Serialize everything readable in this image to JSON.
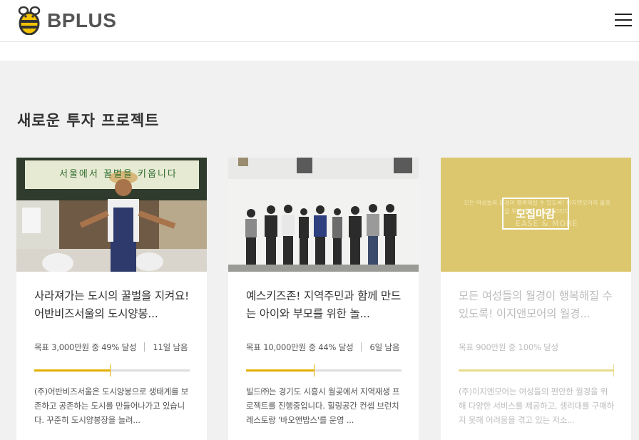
{
  "header": {
    "logo_text": "BPLUS",
    "logo_icon": "bee-icon",
    "menu_icon": "hamburger-menu-icon"
  },
  "section": {
    "title": "새로운 투자 프로젝트"
  },
  "colors": {
    "accent": "#e3b000",
    "closed_overlay": "#dcc76e",
    "background": "#f1f1f1"
  },
  "cards": [
    {
      "title": "사라져가는 도시의 꿀벌을 지켜요! 어반비즈서울의 도시양봉...",
      "goal": "목표 3,000만원 중 49% 달성",
      "remaining": "11일 남음",
      "progress": 0.49,
      "description": "(주)어반비즈서울은 도시양봉으로 생태계를 보존하고 공존하는 도시를 만들어나가고 있습니다. 꾸준히 도시양봉장을 늘려...",
      "image_banner": "서울에서 꿀벌을 키웁니다"
    },
    {
      "title": "예스키즈존! 지역주민과 함께 만드는 아이와 부모를 위한 놀...",
      "goal": "목표 10,000만원 중 44% 달성",
      "remaining": "6일 남음",
      "progress": 0.44,
      "description": "빌드㈜는 경기도 시흥시 월곶에서 지역재생 프로젝트를 진행중입니다. 힐링공간 컨셉 브런치 레스토랑 '바오앤밥스'를 운영 ..."
    },
    {
      "title": "모든 여성들의 월경이 행복해질 수 있도록! 이지앤모어의 월경...",
      "goal": "목표 900만원 중 100% 달성",
      "remaining": "",
      "progress": 1.0,
      "description": "(주)이지앤모어는 여성들의 편안한 월경을 위해 다양한 서비스를 제공하고, 생리대를 구매하지 못해 어려움을 겪고 있는 저소...",
      "closed_label": "모집마감",
      "overlay_text": "모든 여성들의 월경이 행복해질 수 있도록! 이지앤모어의 월경을 위한 착한 소비를 그리다",
      "overlay_brand": "EASE & MORE"
    }
  ]
}
